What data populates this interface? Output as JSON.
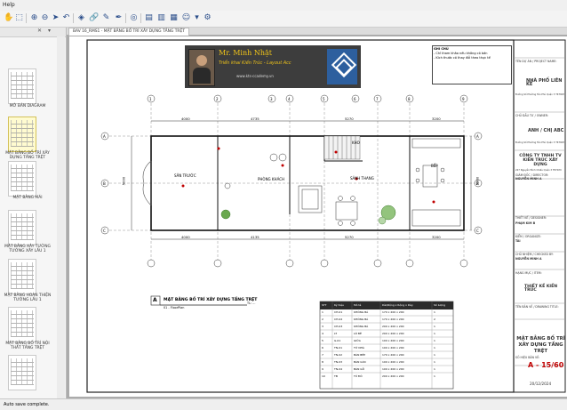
{
  "menu": {
    "help": "Help"
  },
  "toolbar_icons": [
    "hand-tool-icon",
    "select-tool-icon",
    "zoom-in-icon",
    "zoom-out-icon",
    "arrow-dropdown-icon",
    "rotate-left-icon",
    "rotate-right-icon",
    "layer-icon",
    "link-icon",
    "ruler-icon",
    "pen-icon",
    "snapshot-icon",
    "target-icon",
    "bookmark-icon",
    "page-icon",
    "print-icon",
    "bookmark-page-icon",
    "user-icon",
    "dropdown-icon",
    "settings-icon"
  ],
  "tab": {
    "label": "BAV 16_RMS1 - MẶT BẰNG BỐ TRÍ XÂY DỰNG TẦNG TRỆT"
  },
  "sidebar": {
    "pages": [
      "MỞ BẢN DIAGRAM",
      "MẶT BẰNG BỐ TRÍ XÂY DỰNG TẦNG TRỆT",
      "MẶT BẰNG MÁI",
      "MẶT BẰNG XÂY TƯỜNG TƯỜNG XÂY LẦU 1",
      "MẶT BẰNG HOÀN THIỆN TƯỜNG LẦU 1",
      "MẶT BẰNG BỐ TRÍ NỘI THẤT TẦNG TRỆT"
    ]
  },
  "banner": {
    "name": "Mr. Minh Nhật",
    "subtitle": "Triển khai Kiến Trúc - Layout Acc",
    "website": "www.kts-ccademy.vn"
  },
  "notes": {
    "title": "GHI CHÚ",
    "line1": "- Chỉ tham khảo nếu không có bản",
    "line2": "- Kích thước có thay đổi theo thực tế"
  },
  "rooms": {
    "san_truoc": "SÂN TRƯỚC",
    "phong_khach": "PHÒNG KHÁCH",
    "sanh_thang": "SẢNH THANG",
    "bep": "BẾP",
    "kho": "KHO"
  },
  "dims": {
    "top": [
      "4000",
      "4735",
      "5270",
      "3200"
    ],
    "bottom": [
      "4000",
      "4135",
      "5270",
      "3200"
    ],
    "left": "5000",
    "right": "5000"
  },
  "axes": {
    "cols": [
      "1",
      "2",
      "3",
      "4",
      "5",
      "6",
      "7",
      "8",
      "9"
    ],
    "rows": [
      "A",
      "B",
      "C"
    ]
  },
  "plan_title": {
    "key": "A",
    "title": "MẶT BẰNG BỐ TRÍ XÂY DỰNG TẦNG TRỆT",
    "scale": "TL: ...",
    "sub": "01 - FloorPlan"
  },
  "table": {
    "headers": [
      "STT",
      "Ký hiệu",
      "Mô tả",
      "Dài/Rộng x Rộng x Dày",
      "Số lượng"
    ],
    "rows": [
      [
        "1",
        "CH-01",
        "KHÔNG BÁ",
        "170 x 200 x 200",
        "1"
      ],
      [
        "2",
        "CH-02",
        "KHÔNG BÁ",
        "170 x 200 x 200",
        "2"
      ],
      [
        "3",
        "CH-03",
        "KHÔNG BÁ",
        "200 x 200 x 200",
        "1"
      ],
      [
        "4",
        "LT",
        "LÔ BÊ",
        "200 x 200 x 200",
        "1"
      ],
      [
        "5",
        "G-01",
        "GIỮA",
        "100 x 200 x 200",
        "1"
      ],
      [
        "6",
        "TN-01",
        "TỬ NHÀ",
        "100 x 200 x 200",
        "1"
      ],
      [
        "7",
        "TN-02",
        "BÀN BẾP",
        "170 x 200 x 200",
        "1"
      ],
      [
        "8",
        "TN-03",
        "BÀN GÓC",
        "100 x 200 x 200",
        "1"
      ],
      [
        "9",
        "TN-04",
        "BÀN GỖ",
        "100 x 200 x 200",
        "1"
      ],
      [
        "10",
        "TB",
        "TỦ ĐỒ",
        "200 x 200 x 200",
        "1"
      ]
    ]
  },
  "titleblock": {
    "project_label": "TÊN DỰ ÁN / PROJECT NAME:",
    "project": "NHÀ PHỐ LIÊN KẾ",
    "address": "Đường Số Phường Tân Phú Quận 3 TP.HCM",
    "owner_label": "CHỦ ĐẦU TƯ / OWNER:",
    "owner": "ANH / CHỊ ABC",
    "owner_addr": "Đường Số Phường Tân Phú Quận 3 TP.HCM",
    "company": "CÔNG TY TNHH TV KIẾN TRÚC XÂY DỰNG",
    "company_addr": "227 Nguyễn Đình Chiểu Quận 3 TP.HCM",
    "director_label": "GIÁM ĐỐC / DIRECTOR:",
    "director": "NGUYỄN MINH A",
    "drawn_label": "THIẾT KẾ / DESIGNER:",
    "drawn": "PHẠM KIM B",
    "check_label": "KIỂM / ORGANIZE:",
    "check": "TÀI",
    "pm_label": "CHỦ NHIỆM / CHECKED BY:",
    "pm": "NGUYỄN MINH A",
    "stage_label": "HẠNG MỤC / ITEM:",
    "stage": "THIẾT KẾ KIẾN TRÚC",
    "title_label": "TÊN BẢN VẼ / DRAWING TITLE:",
    "drawing_title": "MẶT BẰNG BỐ TRÍ XÂY DỰNG TẦNG TRỆT",
    "sheet_label": "SỐ HIỆU BẢN VẼ:",
    "sheet": "A - 15/60",
    "date": "20/12/2024"
  },
  "status": {
    "text": "Auto save complete."
  }
}
